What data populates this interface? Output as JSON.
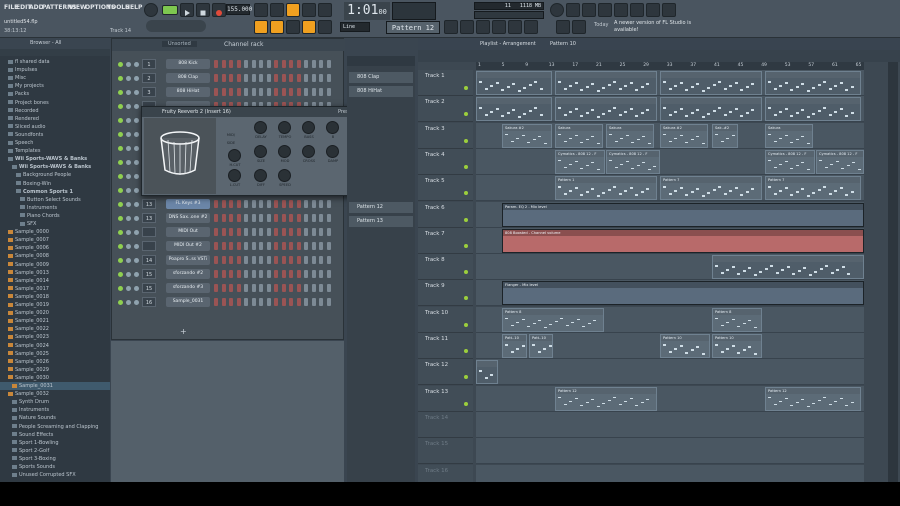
{
  "menu": [
    "FILE",
    "EDIT",
    "ADD",
    "PATTERNS",
    "VIEW",
    "OPTIONS",
    "TOOLS",
    "HELP"
  ],
  "project": {
    "filename": "untitled54.flp",
    "time": "38:13:12",
    "hint": "Track 14"
  },
  "transport": {
    "tempo": "155.000",
    "song_time": "1:01",
    "song_time_sub": "00",
    "memory": "1118 MB",
    "cpu": "11",
    "pattern": "Pattern 12",
    "snap": "Line"
  },
  "news": {
    "date": "Today",
    "text": "A newer version of FL Studio is available!"
  },
  "browser": {
    "title": "Browser - All",
    "items": [
      {
        "label": "fl shared data",
        "level": 1,
        "folder": true
      },
      {
        "label": "Impulses",
        "level": 1,
        "folder": true
      },
      {
        "label": "Misc",
        "level": 1,
        "folder": true
      },
      {
        "label": "My projects",
        "level": 1,
        "folder": true
      },
      {
        "label": "Packs",
        "level": 1,
        "folder": true
      },
      {
        "label": "Project bones",
        "level": 1,
        "folder": true
      },
      {
        "label": "Recorded",
        "level": 1,
        "folder": true
      },
      {
        "label": "Rendered",
        "level": 1,
        "folder": true
      },
      {
        "label": "Sliced audio",
        "level": 1,
        "folder": true
      },
      {
        "label": "Soundfonts",
        "level": 1,
        "folder": true
      },
      {
        "label": "Speech",
        "level": 1,
        "folder": true
      },
      {
        "label": "Templates",
        "level": 1,
        "folder": true
      },
      {
        "label": "Wii Sports-WAVS & Banks",
        "level": 1,
        "folder": true,
        "bold": true
      },
      {
        "label": "Wii Sports-WAVS & Banks",
        "level": 2,
        "folder": true,
        "bold": true
      },
      {
        "label": "Background People",
        "level": 3,
        "folder": true
      },
      {
        "label": "Boxing-Win",
        "level": 3,
        "folder": true
      },
      {
        "label": "Common Sports 1",
        "level": 3,
        "folder": true,
        "bold": true
      },
      {
        "label": "Button Select Sounds",
        "level": 4,
        "folder": true
      },
      {
        "label": "Instruments",
        "level": 4,
        "folder": true
      },
      {
        "label": "Piano Chords",
        "level": 4,
        "folder": true
      },
      {
        "label": "SFX",
        "level": 4,
        "folder": true
      },
      {
        "label": "Sample_0000",
        "level": 1
      },
      {
        "label": "Sample_0007",
        "level": 1
      },
      {
        "label": "Sample_0006",
        "level": 1
      },
      {
        "label": "Sample_0008",
        "level": 1
      },
      {
        "label": "Sample_0009",
        "level": 1
      },
      {
        "label": "Sample_0013",
        "level": 1
      },
      {
        "label": "Sample_0014",
        "level": 1
      },
      {
        "label": "Sample_0017",
        "level": 1
      },
      {
        "label": "Sample_0018",
        "level": 1
      },
      {
        "label": "Sample_0019",
        "level": 1
      },
      {
        "label": "Sample_0020",
        "level": 1
      },
      {
        "label": "Sample_0021",
        "level": 1
      },
      {
        "label": "Sample_0022",
        "level": 1
      },
      {
        "label": "Sample_0023",
        "level": 1
      },
      {
        "label": "Sample_0024",
        "level": 1
      },
      {
        "label": "Sample_0025",
        "level": 1
      },
      {
        "label": "Sample_0026",
        "level": 1
      },
      {
        "label": "Sample_0029",
        "level": 1
      },
      {
        "label": "Sample_0030",
        "level": 1
      },
      {
        "label": "Sample_0031",
        "level": 2,
        "selected": true
      },
      {
        "label": "Sample_0032",
        "level": 1
      },
      {
        "label": "Synth Drum",
        "level": 2,
        "folder": true
      },
      {
        "label": "Instruments",
        "level": 2,
        "folder": true
      },
      {
        "label": "Nature Sounds",
        "level": 2,
        "folder": true
      },
      {
        "label": "People Screaming and Clapping",
        "level": 2,
        "folder": true
      },
      {
        "label": "Sound Effects",
        "level": 2,
        "folder": true
      },
      {
        "label": "Sport 1-Bowling",
        "level": 2,
        "folder": true
      },
      {
        "label": "Sport 2-Golf",
        "level": 2,
        "folder": true
      },
      {
        "label": "Sport 3-Boxing",
        "level": 2,
        "folder": true
      },
      {
        "label": "Sports Sounds",
        "level": 2,
        "folder": true
      },
      {
        "label": "Unused Corrupted SFX",
        "level": 2,
        "folder": true
      }
    ]
  },
  "channel_rack": {
    "filter": "Unsorted",
    "title": "Channel rack",
    "channels": [
      {
        "num": "1",
        "name": "808 Kick"
      },
      {
        "num": "2",
        "name": "808 Clap"
      },
      {
        "num": "3",
        "name": "808 HiHat"
      },
      {
        "num": "",
        "name": ""
      },
      {
        "num": "",
        "name": ""
      },
      {
        "num": "",
        "name": ""
      },
      {
        "num": "",
        "name": ""
      },
      {
        "num": "",
        "name": ""
      },
      {
        "num": "",
        "name": ""
      },
      {
        "num": "",
        "name": ""
      },
      {
        "num": "13",
        "name": "FL Keys #3"
      },
      {
        "num": "13",
        "name": "DNS Sax..one #2"
      },
      {
        "num": "",
        "name": "MIDI Out"
      },
      {
        "num": "",
        "name": "MIDI Out #2"
      },
      {
        "num": "14",
        "name": "Poapro S..ss VSTi"
      },
      {
        "num": "15",
        "name": "sforzando #2"
      },
      {
        "num": "15",
        "name": "sforzando #3"
      },
      {
        "num": "16",
        "name": "Sample_0031"
      }
    ]
  },
  "reverb": {
    "title": "Fruity Reeverb 2 (Insert 16)",
    "presets": "Presets",
    "labels": [
      "MID/",
      "SIDE",
      "H.CUT",
      "L.CUT",
      "DELAY",
      "SIZE",
      "DIFF",
      "MOD",
      "SPEED",
      "TEMPO",
      "BASS",
      "CROSS",
      "DAMP",
      "DRY",
      "ER",
      "WET",
      "E.SP",
      "B"
    ]
  },
  "patterns": [
    "808 Clap",
    "808 HiHat",
    "Pattern 12",
    "Pattern 13"
  ],
  "playlist": {
    "title": "Playlist - Arrangement",
    "pattern": "Pattern 10",
    "bars": [
      "1",
      "5",
      "9",
      "13",
      "17",
      "21",
      "25",
      "29",
      "33",
      "37",
      "41",
      "45",
      "49",
      "53",
      "57",
      "61",
      "65"
    ],
    "tracks": [
      "Track 1",
      "Track 2",
      "Track 3",
      "Track 4",
      "Track 5",
      "Track 6",
      "Track 7",
      "Track 8",
      "Track 9",
      "Track 10",
      "Track 11",
      "Track 12",
      "Track 13",
      "Track 14",
      "Track 15",
      "Track 16"
    ],
    "clips": {
      "t3": [
        "Sakura #2",
        "Sakura",
        "Sakura",
        "Sakura #2",
        "Sak..#2",
        "Sakura"
      ],
      "t4": [
        "Cymatics - 808 12 - F",
        "Cymatics - 808 12 - F",
        "Cymatics - 808 12 - F",
        "Cymatics - 808 12 - F"
      ],
      "t5": [
        "Pattern 1",
        "Pattern 7",
        "Pattern 7"
      ],
      "t6": "Param. EQ 2 - Mix level",
      "t7": "808 Boosted - Channel volume",
      "t9": "Flanger - Mix level",
      "t10": [
        "Pattern 8",
        "Pattern 8"
      ],
      "t11": [
        "Patt..10",
        "Patt..10",
        "Pattern 10",
        "Pattern 10"
      ],
      "t13": [
        "Pattern 12",
        "Pattern 12"
      ]
    }
  }
}
